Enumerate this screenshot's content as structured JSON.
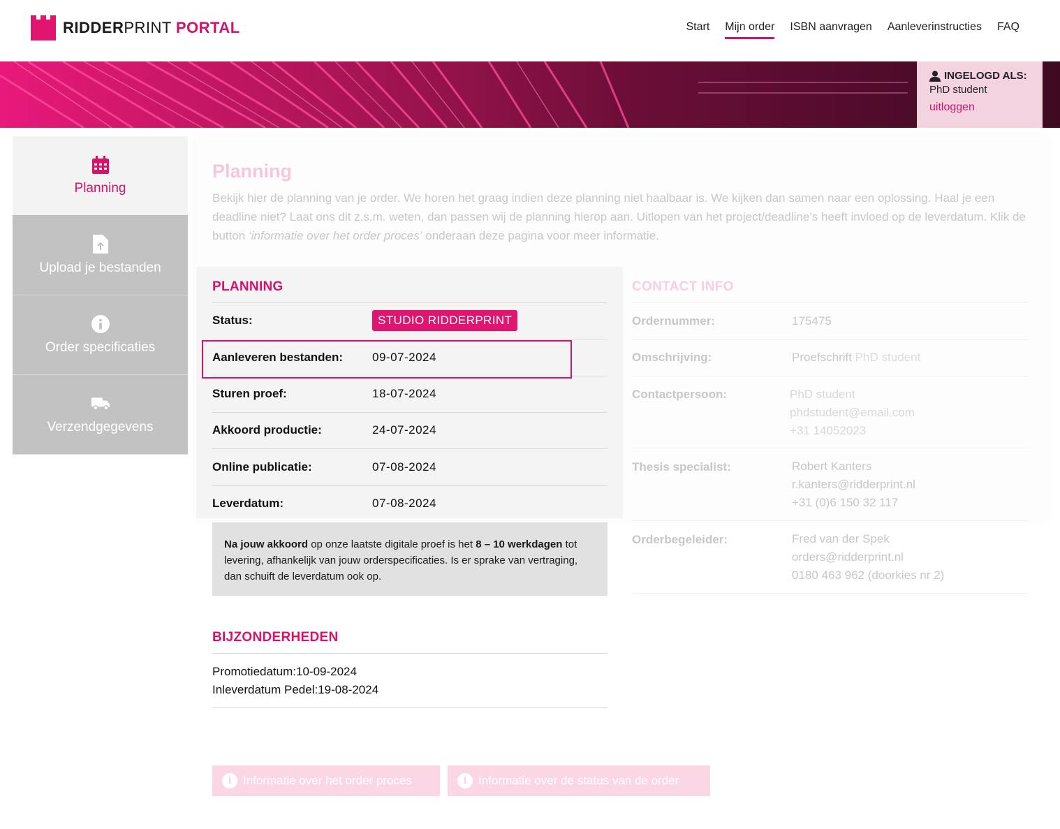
{
  "brand": {
    "name_bold": "RIDDER",
    "name_regular": "PRINT",
    "name_accent": "PORTAL",
    "accent_color": "#d6126b"
  },
  "nav": [
    {
      "label": "Start",
      "active": false
    },
    {
      "label": "Mijn order",
      "active": true
    },
    {
      "label": "ISBN aanvragen",
      "active": false
    },
    {
      "label": "Aanleverinstructies",
      "active": false
    },
    {
      "label": "FAQ",
      "active": false
    }
  ],
  "login": {
    "title": "INGELOGD ALS:",
    "user": "PhD student",
    "logout": "uitloggen",
    "icon": "user-icon"
  },
  "sidebar": [
    {
      "label": "Planning",
      "icon": "calendar-icon",
      "active": true
    },
    {
      "label": "Upload je bestanden",
      "icon": "file-upload-icon",
      "active": false
    },
    {
      "label": "Order specificaties",
      "icon": "info-icon",
      "active": false
    },
    {
      "label": "Verzendgegevens",
      "icon": "truck-icon",
      "active": false
    }
  ],
  "page": {
    "title": "Planning",
    "intro_1": "Bekijk hier de planning van je order. We horen het graag indien deze planning niet haalbaar is. We kijken dan samen naar een oplossing. Haal je een deadline niet? Laat ons dit z.s.m. weten, dan passen wij de planning hierop aan. Uitlopen van het project/deadline’s heeft invloed op de leverdatum. Klik de button ",
    "intro_italic": "‘informatie over het order proces’",
    "intro_2": " onderaan deze pagina voor meer informatie."
  },
  "planning": {
    "heading": "PLANNING",
    "status_label": "Status:",
    "status_value": "STUDIO RIDDERPRINT",
    "rows": [
      {
        "label": "Aanleveren bestanden:",
        "value": "09-07-2024"
      },
      {
        "label": "Sturen proef:",
        "value": "18-07-2024"
      },
      {
        "label": "Akkoord productie:",
        "value": "24-07-2024"
      },
      {
        "label": "Online publicatie:",
        "value": "07-08-2024"
      },
      {
        "label": "Leverdatum:",
        "value": "07-08-2024"
      }
    ],
    "note": {
      "b1": "Na jouw akkoord",
      "t1": " op onze laatste digitale proef is het ",
      "b2": "8 – 10 werkdagen",
      "t2": " tot levering, afhankelijk van jouw orderspecificaties. Is er sprake van vertraging, dan schuift de leverdatum ook op."
    }
  },
  "bijzonderheden": {
    "heading": "BIJZONDERHEDEN",
    "lines": [
      "Promotiedatum:10-09-2024",
      "Inleverdatum Pedel:19-08-2024"
    ]
  },
  "contact": {
    "heading": "CONTACT INFO",
    "ordernummer_label": "Ordernummer:",
    "ordernummer": "175475",
    "omschrijving_label": "Omschrijving:",
    "omschrijving_a": "Proefschrift",
    "omschrijving_b": "PhD student",
    "contactpersoon_label": "Contactpersoon:",
    "contactpersoon": [
      "PhD student",
      "phdstudent@email.com",
      "+31 14052023"
    ],
    "specialist_label": "Thesis specialist:",
    "specialist": [
      "Robert Kanters",
      "r.kanters@ridderprint.nl",
      "+31 (0)6 150 32 117"
    ],
    "begeleider_label": "Orderbegeleider:",
    "begeleider": [
      "Fred van der Spek",
      "orders@ridderprint.nl",
      "0180 463 962 (doorkies nr 2)"
    ]
  },
  "buttons": {
    "proces": "Informatie over het order proces",
    "status": "Informatie over de status van de order"
  }
}
